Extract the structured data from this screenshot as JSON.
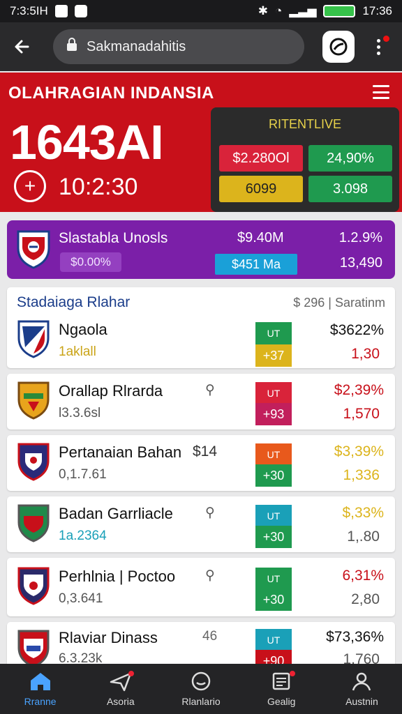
{
  "status": {
    "time": "7:3:5ΙΗ",
    "network": "4G",
    "battery_label": "",
    "clock": "17:36"
  },
  "browser": {
    "url": "Sakmanadahitis"
  },
  "hero": {
    "title": "OLAHRAGIAN INDANSIA",
    "score": "1643AI",
    "time": "10:2:30",
    "live_title": "RITENTLIVE",
    "cells": [
      {
        "text": "$2.280Ol",
        "color": "#d9233a"
      },
      {
        "text": "24,90%",
        "color": "#1f9a4f"
      },
      {
        "text": "6099",
        "color": "#dcb41c"
      },
      {
        "text": "3.098",
        "color": "#1f9a4f"
      }
    ]
  },
  "promo": {
    "name": "Slastabla Unosls",
    "pill": "$0.00%",
    "value1": "$9.40M",
    "value2": "1.2.9%",
    "blue_label": "$451 Ma",
    "value3": "13,490"
  },
  "section": {
    "title": "Stadaiaga Rlahar",
    "meta": "$ 296  |  Saratinm"
  },
  "rows": [
    {
      "name": "Ngaola",
      "sub": "1aklall",
      "sub_color": "#caa418",
      "mid": "",
      "ut": "UT",
      "ut_color": "#1f9a4f",
      "odd": "+37",
      "odd_color": "#dcb41c",
      "r1": "$3622%",
      "r1_color": "#111111",
      "r2": "1,30",
      "r2_color": "#c8101a",
      "crest": [
        "#1b3d8a",
        "#c8101a"
      ]
    },
    {
      "name": "Orallap Rlrarda",
      "sub": "l3.3.6sl",
      "sub_color": "#555555",
      "mid": "",
      "ut": "UT",
      "ut_color": "#d9233a",
      "odd": "+93",
      "odd_color": "#c21f5c",
      "r1": "$2,39%",
      "r1_color": "#c8101a",
      "r2": "1,570",
      "r2_color": "#c8101a",
      "crest": [
        "#e8a41c",
        "#2a8a3a"
      ]
    },
    {
      "name": "Pertanaian Bahan",
      "sub": "0,1.7.61",
      "sub_color": "#555555",
      "mid": "$14",
      "ut": "UT",
      "ut_color": "#e8591c",
      "odd": "+30",
      "odd_color": "#1f9a4f",
      "r1": "$3,39%",
      "r1_color": "#dcb41c",
      "r2": "1,336",
      "r2_color": "#dcb41c",
      "crest": [
        "#2a2a7a",
        "#c8101a"
      ]
    },
    {
      "name": "Badan Garrliacle",
      "sub": "1a.2364",
      "sub_color": "#1aa0b8",
      "mid": "",
      "ut": "UT",
      "ut_color": "#1aa0b8",
      "odd": "+30",
      "odd_color": "#1f9a4f",
      "r1": "$,33%",
      "r1_color": "#dcb41c",
      "r2": "1,.80",
      "r2_color": "#555555",
      "crest": [
        "#1f8a4a",
        "#c8101a"
      ]
    },
    {
      "name": "Perhlnia  |  Poctoo",
      "sub": "0,3.641",
      "sub_color": "#555555",
      "mid": "",
      "ut": "UT",
      "ut_color": "#1f9a4f",
      "odd": "+30",
      "odd_color": "#1f9a4f",
      "r1": "6,31%",
      "r1_color": "#c8101a",
      "r2": "2,80",
      "r2_color": "#555555",
      "crest": [
        "#2a2a6a",
        "#c8101a"
      ]
    },
    {
      "name": "Rlaviar Dinass",
      "sub": "6.3.23k",
      "sub_color": "#555555",
      "mid": "46",
      "ut": "UT",
      "ut_color": "#1aa0b8",
      "odd": "+90",
      "odd_color": "#c8101a",
      "r1": "$73,36%",
      "r1_color": "#111111",
      "r2": "1,760",
      "r2_color": "#555555",
      "crest": [
        "#c8101a",
        "#2a4aaa"
      ]
    }
  ],
  "nav": [
    {
      "label": "Rranne",
      "active": true
    },
    {
      "label": "Asoria",
      "active": false
    },
    {
      "label": "Rlanlario",
      "active": false
    },
    {
      "label": "Gealig",
      "active": false
    },
    {
      "label": "Austnin",
      "active": false
    }
  ]
}
